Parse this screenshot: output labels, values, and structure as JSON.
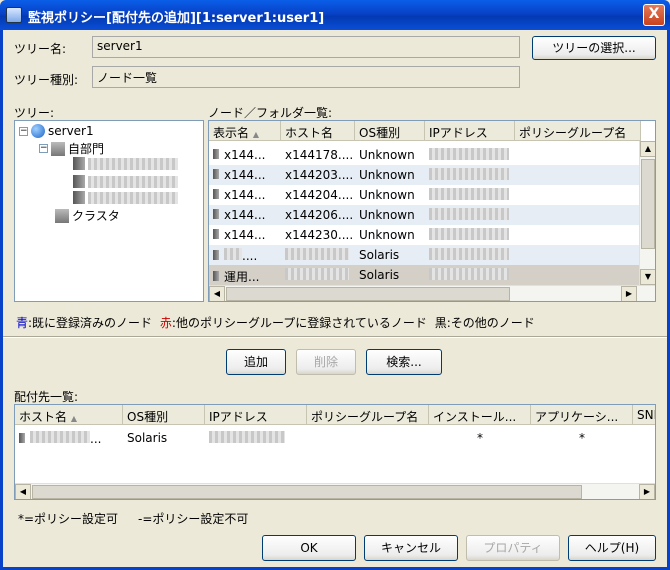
{
  "window": {
    "title": "監視ポリシー[配付先の追加][1:server1:user1]",
    "close_label": "X"
  },
  "tree_name": {
    "label": "ツリー名:",
    "value": "server1",
    "select_button": "ツリーの選択..."
  },
  "tree_type": {
    "label": "ツリー種別:",
    "value": "ノード一覧"
  },
  "tree": {
    "label": "ツリー:",
    "root": "server1",
    "department": "自部門",
    "cluster": "クラスタ"
  },
  "node_list": {
    "label": "ノード／フォルダ一覧:",
    "columns": [
      "表示名",
      "ホスト名",
      "OS種別",
      "IPアドレス",
      "ポリシーグループ名"
    ],
    "rows": [
      [
        "x144...",
        "x144178....",
        "Unknown"
      ],
      [
        "x144...",
        "x144203....",
        "Unknown"
      ],
      [
        "x144...",
        "x144204....",
        "Unknown"
      ],
      [
        "x144...",
        "x144206....",
        "Unknown"
      ],
      [
        "x144...",
        "x144230....",
        "Unknown"
      ],
      [
        "",
        "",
        "Solaris"
      ],
      [
        "運用...",
        "",
        "Solaris"
      ]
    ],
    "row_suffix_6": "....",
    "sort_mark": "▲"
  },
  "legend": {
    "blue_key": "青",
    "blue_text": ":既に登録済みのノード",
    "red_key": "赤",
    "red_text": ":他のポリシーグループに登録されているノード",
    "black_text": "黒:その他のノード",
    "colors": {
      "blue": "#0000cc",
      "red": "#cc0000"
    }
  },
  "actions": {
    "add": "追加",
    "remove": "削除",
    "search": "検索..."
  },
  "dest_list": {
    "label": "配付先一覧:",
    "columns": [
      "ホスト名",
      "OS種別",
      "IPアドレス",
      "ポリシーグループ名",
      "インストール...",
      "アプリケーシ...",
      "SNMP"
    ],
    "rows": [
      [
        "...",
        "Solaris",
        "",
        "",
        "*",
        "*",
        ""
      ]
    ]
  },
  "notes": {
    "settable": "*=ポリシー設定可",
    "not_settable": "-=ポリシー設定不可"
  },
  "footer": {
    "ok": "OK",
    "cancel": "キャンセル",
    "properties": "プロパティ",
    "help": "ヘルプ(H)"
  }
}
